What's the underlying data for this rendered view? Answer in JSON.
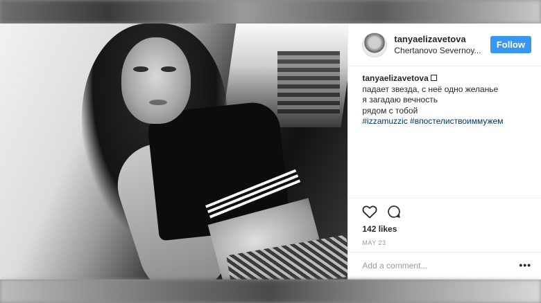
{
  "post": {
    "username": "tanyaelizavetova",
    "location": "Chertanovo Severnoy...",
    "follow_label": "Follow",
    "caption": {
      "username": "tanyaelizavetova",
      "lines": [
        "падает звезда, с неё одно желанье",
        "я загадаю вечность",
        "рядом с тобой"
      ],
      "hashtags": "#izzamuzzic #впостелиствоиммужем"
    },
    "likes": "142 likes",
    "date": "MAY 23",
    "comment_placeholder": "Add a comment...",
    "more_label": "•••"
  },
  "icons": {
    "like": "heart-icon",
    "comment": "comment-bubble-icon",
    "more": "more-options-icon"
  },
  "colors": {
    "follow_button": "#3897f0",
    "hashtag": "#003569",
    "text": "#262626",
    "muted": "#999999"
  }
}
